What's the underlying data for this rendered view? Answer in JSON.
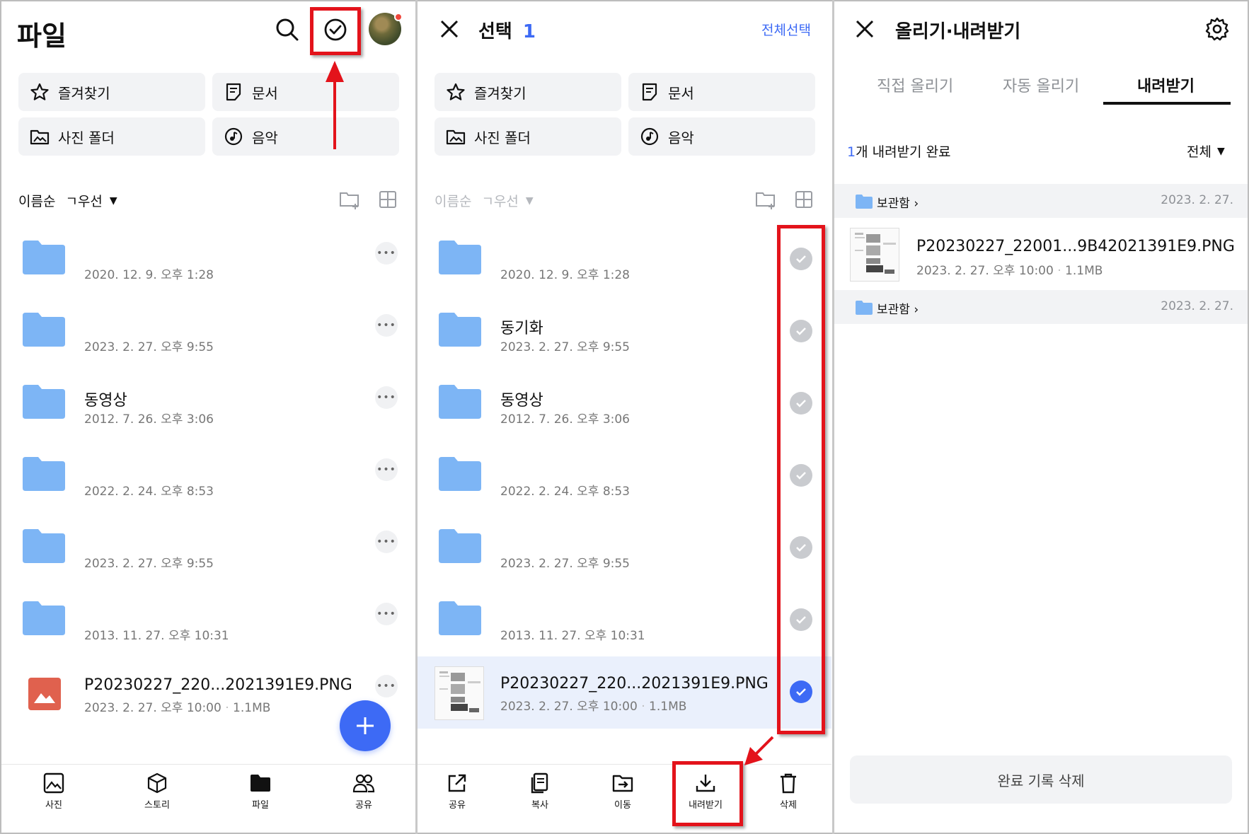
{
  "colors": {
    "accent": "#3d6af5",
    "highlight": "#e3131b",
    "folder": "#7db5f5",
    "image_icon": "#e0614e"
  },
  "panel1": {
    "title": "파일",
    "icons": [
      "search-icon",
      "select-check-icon",
      "avatar"
    ],
    "quick": [
      {
        "label": "즐겨찾기",
        "icon": "star-icon"
      },
      {
        "label": "문서",
        "icon": "document-icon"
      },
      {
        "label": "사진 폴더",
        "icon": "photo-folder-icon"
      },
      {
        "label": "음악",
        "icon": "music-icon"
      }
    ],
    "sort": {
      "order": "이름순",
      "priority": "ㄱ우선"
    },
    "rows": [
      {
        "name": "",
        "date": "2020. 12. 9. 오후 1:28"
      },
      {
        "name": "",
        "date": "2023. 2. 27. 오후 9:55"
      },
      {
        "name": "동영상",
        "date": "2012. 7. 26. 오후 3:06"
      },
      {
        "name": "",
        "date": "2022. 2. 24. 오후 8:53"
      },
      {
        "name": "",
        "date": "2023. 2. 27. 오후 9:55"
      },
      {
        "name": "",
        "date": "2013. 11. 27. 오후 10:31"
      },
      {
        "name": "P20230227_220...2021391E9.PNG",
        "date": "2023. 2. 27. 오후 10:00",
        "size": "1.1MB"
      }
    ],
    "more": "•••",
    "nav": [
      {
        "label": "사진"
      },
      {
        "label": "스토리"
      },
      {
        "label": "파일"
      },
      {
        "label": "공유"
      }
    ]
  },
  "panel2": {
    "title": "선택",
    "count": "1",
    "select_all": "전체선택",
    "quick": [
      {
        "label": "즐겨찾기"
      },
      {
        "label": "문서"
      },
      {
        "label": "사진 폴더"
      },
      {
        "label": "음악"
      }
    ],
    "sort": {
      "order": "이름순",
      "priority": "ㄱ우선"
    },
    "rows": [
      {
        "name": "",
        "date": "2020. 12. 9. 오후 1:28"
      },
      {
        "name": "동기화",
        "date": "2023. 2. 27. 오후 9:55"
      },
      {
        "name": "동영상",
        "date": "2012. 7. 26. 오후 3:06"
      },
      {
        "name": "",
        "date": "2022. 2. 24. 오후 8:53"
      },
      {
        "name": "",
        "date": "2023. 2. 27. 오후 9:55"
      },
      {
        "name": "",
        "date": "2013. 11. 27. 오후 10:31"
      },
      {
        "name": "P20230227_220...2021391E9.PNG",
        "date": "2023. 2. 27. 오후 10:00",
        "size": "1.1MB",
        "selected": true
      }
    ],
    "actions": [
      {
        "label": "공유"
      },
      {
        "label": "복사"
      },
      {
        "label": "이동"
      },
      {
        "label": "내려받기"
      },
      {
        "label": "삭제"
      }
    ]
  },
  "panel3": {
    "title": "올리기·내려받기",
    "tabs": [
      {
        "label": "직접 올리기"
      },
      {
        "label": "자동 올리기"
      },
      {
        "label": "내려받기"
      }
    ],
    "status": {
      "count": "1",
      "text": "개 내려받기 완료"
    },
    "filter": "전체",
    "groups": [
      {
        "name": "보관함",
        "date": "2023. 2. 27."
      },
      {
        "name": "보관함",
        "date": "2023. 2. 27."
      }
    ],
    "item": {
      "name": "P20230227_22001...9B42021391E9.PNG",
      "date": "2023. 2. 27. 오후 10:00",
      "size": "1.1MB"
    },
    "clear_button": "완료 기록 삭제"
  }
}
